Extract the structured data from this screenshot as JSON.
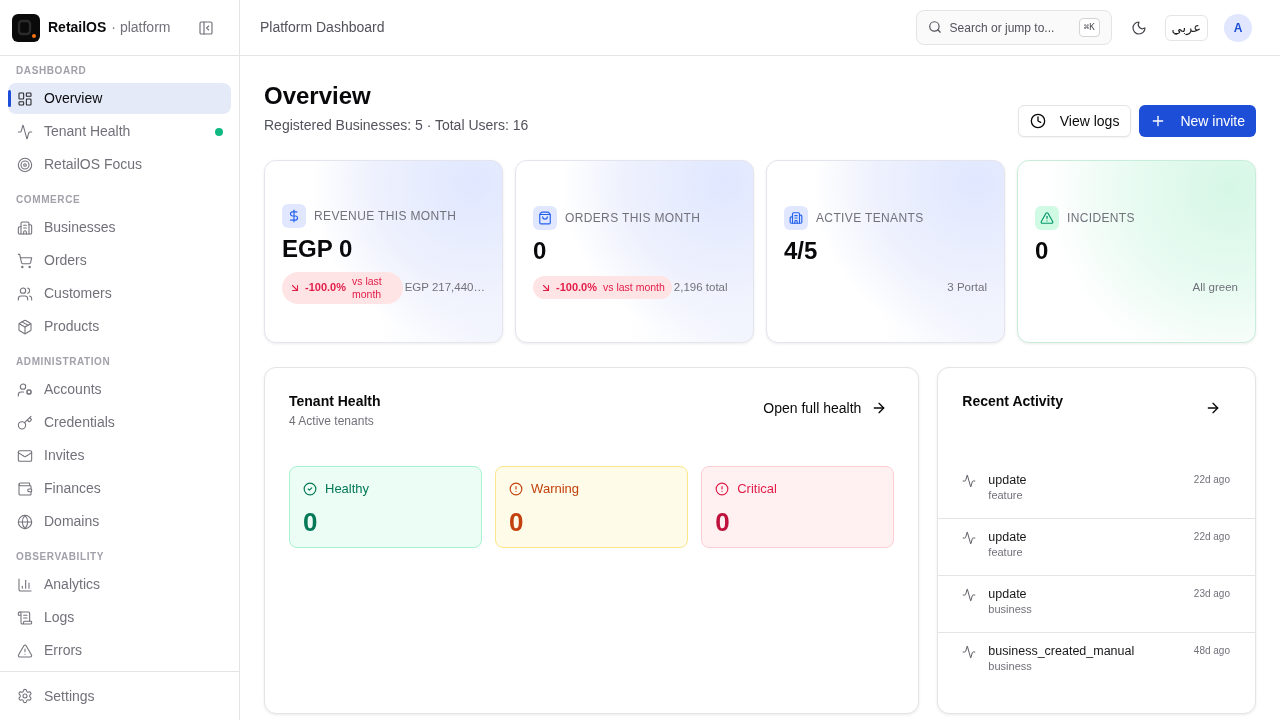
{
  "sidebar": {
    "brand": {
      "name": "RetailOS",
      "suffix": "· platform"
    },
    "sections": [
      {
        "heading": "DASHBOARD",
        "items": [
          {
            "label": "Overview",
            "selected": true
          },
          {
            "label": "Tenant Health",
            "selected": false,
            "color": "#10b981"
          },
          {
            "label": "RetailOS Focus",
            "selected": false
          }
        ]
      },
      {
        "heading": "COMMERCE",
        "items": [
          {
            "label": "Businesses",
            "selected": false
          },
          {
            "label": "Orders",
            "selected": false
          },
          {
            "label": "Customers",
            "selected": false
          },
          {
            "label": "Products",
            "selected": false
          }
        ]
      },
      {
        "heading": "ADMINISTRATION",
        "items": [
          {
            "label": "Accounts",
            "selected": false
          },
          {
            "label": "Credentials",
            "selected": false
          },
          {
            "label": "Invites",
            "selected": false
          },
          {
            "label": "Finances",
            "selected": false
          },
          {
            "label": "Domains",
            "selected": false
          }
        ]
      },
      {
        "heading": "OBSERVABILITY",
        "items": [
          {
            "label": "Analytics",
            "selected": false
          },
          {
            "label": "Logs",
            "selected": false
          },
          {
            "label": "Errors",
            "selected": false
          }
        ]
      }
    ],
    "footer": {
      "label": "Settings"
    }
  },
  "header": {
    "title": "Platform Dashboard",
    "search": {
      "placeholder": "Search or jump to...",
      "shortcut": "⌘K"
    },
    "language": "عربي",
    "avatar": "A"
  },
  "page": {
    "title": "Overview",
    "subtitle": "Registered Businesses: 5 · Total Users: 16",
    "actions": [
      {
        "label": "View logs",
        "kind": "secondary"
      },
      {
        "label": "New invite",
        "kind": "primary"
      }
    ]
  },
  "stats": [
    {
      "kind": "metric",
      "label": "REVENUE THIS MONTH",
      "value": "EGP 0",
      "trend": {
        "down": true,
        "value": "-100.0%",
        "caption": "vs last month"
      },
      "note": "EGP 217,440…"
    },
    {
      "kind": "metric",
      "label": "ORDERS THIS MONTH",
      "value": "0",
      "trend": {
        "down": true,
        "value": "-100.0%",
        "caption": "vs last month"
      },
      "note": "2,196 total"
    },
    {
      "kind": "metric",
      "label": "ACTIVE TENANTS",
      "value": "4/5",
      "note": "3 Portal"
    },
    {
      "kind": "health",
      "label": "INCIDENTS",
      "value": "0",
      "note": "All green"
    }
  ],
  "tenant_health": {
    "title": "Tenant Health",
    "subtitle": "4 Active tenants",
    "link": "Open full health",
    "statuses": [
      {
        "kind": "healthy",
        "label": "Healthy",
        "value": "0"
      },
      {
        "kind": "warning",
        "label": "Warning",
        "value": "0"
      },
      {
        "kind": "critical",
        "label": "Critical",
        "value": "0"
      }
    ]
  },
  "recent_activity": {
    "title": "Recent Activity",
    "items": [
      {
        "title": "update",
        "category": "feature",
        "time": "22d ago"
      },
      {
        "title": "update",
        "category": "feature",
        "time": "22d ago"
      },
      {
        "title": "update",
        "category": "business",
        "time": "23d ago"
      },
      {
        "title": "business_created_manual",
        "category": "business",
        "time": "48d ago"
      }
    ]
  }
}
